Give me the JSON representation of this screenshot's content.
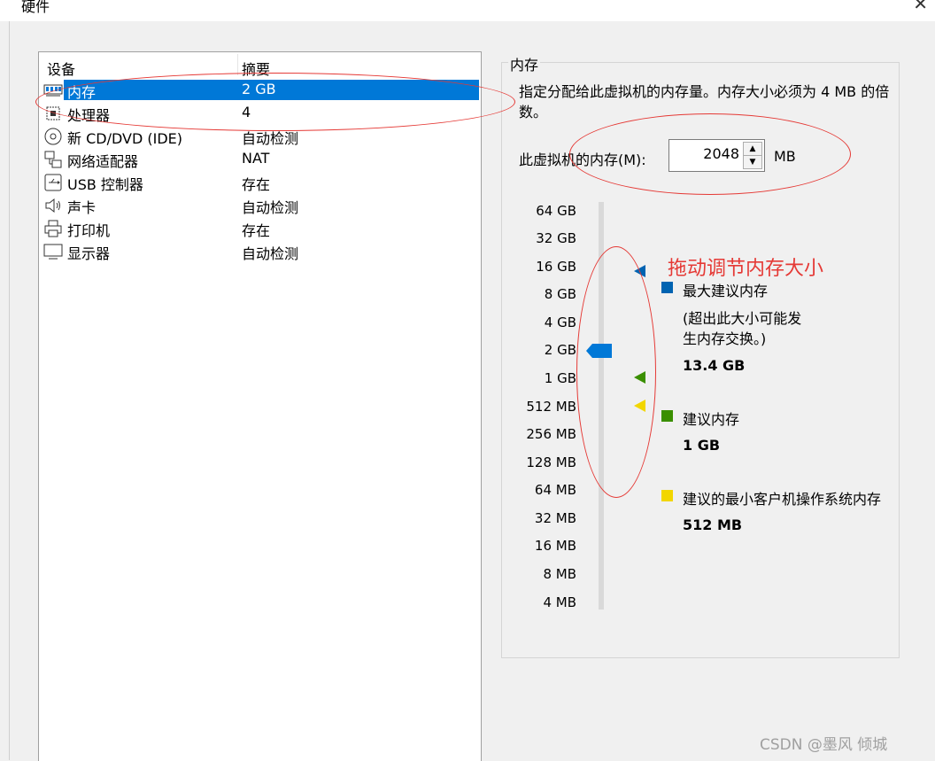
{
  "window": {
    "title": "硬件",
    "close_glyph": "✕"
  },
  "device_list": {
    "headers": {
      "device": "设备",
      "summary": "摘要"
    },
    "rows": [
      {
        "name": "内存",
        "summary": "2 GB",
        "icon": "memory-icon",
        "selected": true
      },
      {
        "name": "处理器",
        "summary": "4",
        "icon": "processor-icon",
        "selected": false
      },
      {
        "name": "新 CD/DVD (IDE)",
        "summary": "自动检测",
        "icon": "cd-dvd-icon",
        "selected": false
      },
      {
        "name": "网络适配器",
        "summary": "NAT",
        "icon": "network-adapter-icon",
        "selected": false
      },
      {
        "name": "USB 控制器",
        "summary": "存在",
        "icon": "usb-icon",
        "selected": false
      },
      {
        "name": "声卡",
        "summary": "自动检测",
        "icon": "speaker-icon",
        "selected": false
      },
      {
        "name": "打印机",
        "summary": "存在",
        "icon": "printer-icon",
        "selected": false
      },
      {
        "name": "显示器",
        "summary": "自动检测",
        "icon": "monitor-icon",
        "selected": false
      }
    ]
  },
  "memory": {
    "group_title": "内存",
    "description": "指定分配给此虚拟机的内存量。内存大小必须为 4 MB 的倍数。",
    "field_label": "此虚拟机的内存(M):",
    "value": "2048",
    "unit": "MB",
    "scale_ticks": [
      "64 GB",
      "32 GB",
      "16 GB",
      "8 GB",
      "4 GB",
      "2 GB",
      "1 GB",
      "512 MB",
      "256 MB",
      "128 MB",
      "64 MB",
      "32 MB",
      "16 MB",
      "8 MB",
      "4 MB"
    ],
    "slider_value": "2 GB",
    "legend": {
      "max": {
        "label": "最大建议内存",
        "note": "(超出此大小可能发生内存交换。)",
        "value": "13.4 GB",
        "color": "#0063b1"
      },
      "recommended": {
        "label": "建议内存",
        "value": "1 GB",
        "color": "#3a8f00"
      },
      "min_os": {
        "label": "建议的最小客户机操作系统内存",
        "value": "512 MB",
        "color": "#f2d600"
      }
    },
    "slider_color": "#0078d7"
  },
  "annotation": {
    "text": "拖动调节内存大小",
    "color": "#e53935"
  },
  "watermark": "CSDN @墨风 倾城"
}
